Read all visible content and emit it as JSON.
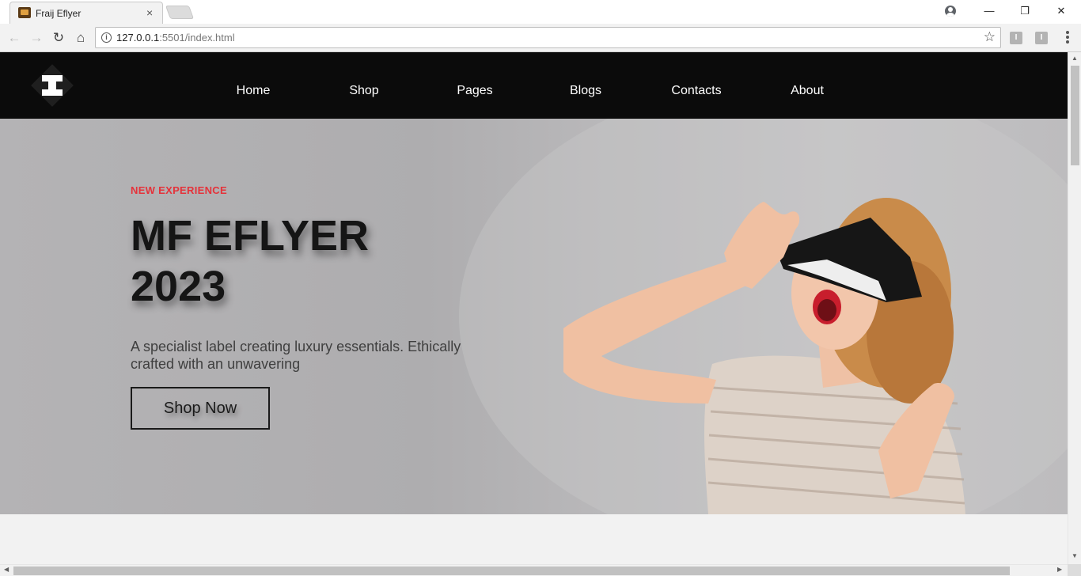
{
  "browser": {
    "tab_title": "Fraij Eflyer",
    "url_host": "127.0.0.1",
    "url_rest": ":5501/index.html",
    "window_controls": {
      "minimize": "—",
      "restore": "❐",
      "close": "✕"
    },
    "tab_close": "×"
  },
  "site": {
    "nav": [
      "Home",
      "Shop",
      "Pages",
      "Blogs",
      "Contacts",
      "About"
    ]
  },
  "hero": {
    "kicker": "NEW EXPERIENCE",
    "title": "MF EFLYER 2023",
    "description": "A specialist label creating luxury essentials. Ethically crafted with an unwavering",
    "cta": "Shop Now"
  },
  "colors": {
    "header_bg": "#0b0b0b",
    "kicker": "#e5323a",
    "hero_bg": "#b4b3b5"
  },
  "icons": [
    "back-arrow-icon",
    "forward-arrow-icon",
    "reload-icon",
    "home-icon",
    "info-icon",
    "star-icon",
    "profile-icon",
    "menu-icon",
    "logo-icon"
  ]
}
